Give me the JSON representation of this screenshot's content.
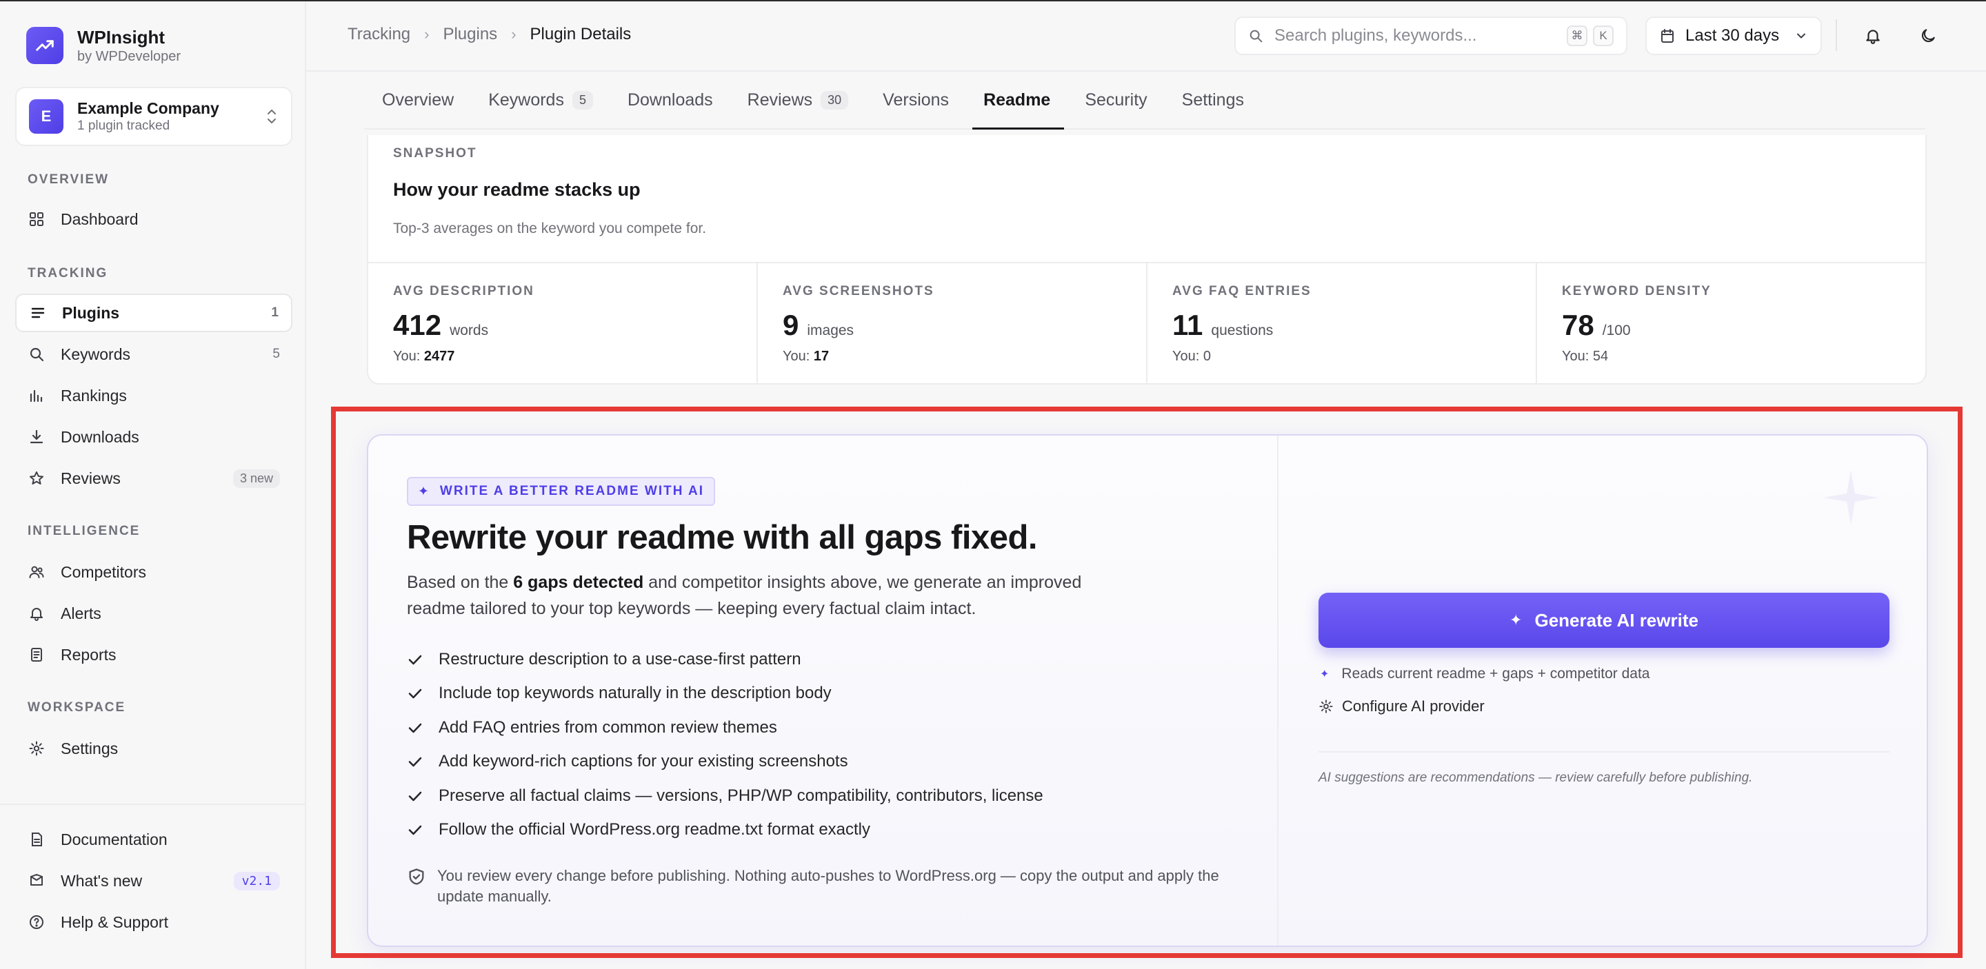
{
  "brand": {
    "name": "WPInsight",
    "sub": "by WPDeveloper"
  },
  "org": {
    "initial": "E",
    "name": "Example Company",
    "sub": "1 plugin tracked"
  },
  "nav": {
    "overview_label": "OVERVIEW",
    "dashboard": "Dashboard",
    "tracking_label": "TRACKING",
    "plugins": "Plugins",
    "plugins_count": "1",
    "keywords": "Keywords",
    "keywords_count": "5",
    "rankings": "Rankings",
    "downloads": "Downloads",
    "reviews": "Reviews",
    "reviews_badge": "3 new",
    "intelligence_label": "INTELLIGENCE",
    "competitors": "Competitors",
    "alerts": "Alerts",
    "reports": "Reports",
    "workspace_label": "WORKSPACE",
    "settings": "Settings",
    "documentation": "Documentation",
    "whats_new": "What's new",
    "whats_new_badge": "v2.1",
    "help": "Help & Support"
  },
  "header": {
    "breadcrumbs": [
      "Tracking",
      "Plugins",
      "Plugin Details"
    ],
    "search_placeholder": "Search plugins, keywords...",
    "kbd1": "⌘",
    "kbd2": "K",
    "date_range": "Last 30 days"
  },
  "tabs": [
    {
      "label": "Overview"
    },
    {
      "label": "Keywords",
      "count": "5"
    },
    {
      "label": "Downloads"
    },
    {
      "label": "Reviews",
      "count": "30"
    },
    {
      "label": "Versions"
    },
    {
      "label": "Readme",
      "active": true
    },
    {
      "label": "Security"
    },
    {
      "label": "Settings"
    }
  ],
  "snapshot": {
    "kicker": "SNAPSHOT",
    "title": "How your readme stacks up",
    "desc": "Top-3 averages on the keyword you compete for.",
    "stats": [
      {
        "label": "AVG DESCRIPTION",
        "value": "412",
        "unit": "words",
        "you_prefix": "You:",
        "you": "2477",
        "you_bold": true
      },
      {
        "label": "AVG SCREENSHOTS",
        "value": "9",
        "unit": "images",
        "you_prefix": "You:",
        "you": "17",
        "you_bold": true
      },
      {
        "label": "AVG FAQ ENTRIES",
        "value": "11",
        "unit": "questions",
        "you_prefix": "You:",
        "you": "0",
        "you_bold": false
      },
      {
        "label": "KEYWORD DENSITY",
        "value": "78",
        "unit": "/100",
        "you_prefix": "You:",
        "you": "54",
        "you_bold": false
      }
    ]
  },
  "ai": {
    "kicker": "WRITE A BETTER README WITH AI",
    "title": "Rewrite your readme with all gaps fixed.",
    "desc_pre": "Based on the ",
    "desc_bold": "6 gaps detected",
    "desc_post": " and competitor insights above, we generate an improved readme tailored to your top keywords — keeping every factual claim intact.",
    "checklist": [
      "Restructure description to a use-case-first pattern",
      "Include top keywords naturally in the description body",
      "Add FAQ entries from common review themes",
      "Add keyword-rich captions for your existing screenshots",
      "Preserve all factual claims — versions, PHP/WP compatibility, contributors, license",
      "Follow the official WordPress.org readme.txt format exactly"
    ],
    "note": "You review every change before publishing. Nothing auto-pushes to WordPress.org — copy the output and apply the update manually.",
    "generate_button": "Generate AI rewrite",
    "reads": "Reads current readme + gaps + competitor data",
    "configure": "Configure AI provider",
    "disclaimer": "AI suggestions are recommendations — review carefully before publishing."
  },
  "colors": {
    "accent": "#5a47ea",
    "highlight": "#e53935"
  }
}
